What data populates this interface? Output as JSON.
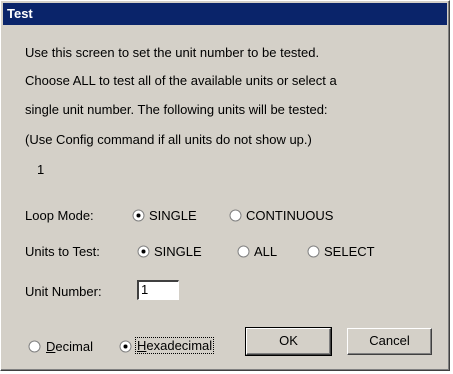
{
  "window": {
    "title": "Test"
  },
  "instructions": {
    "line1": "Use this screen to set the unit number to be tested.",
    "line2": "Choose ALL to test all of the available units or select a",
    "line3": "single unit number.  The following units will be tested:",
    "line4": "(Use Config command if all units do not show up.)",
    "units_listed": "1"
  },
  "loop_mode": {
    "label": "Loop Mode:",
    "options": [
      {
        "label": "SINGLE",
        "selected": true
      },
      {
        "label": "CONTINUOUS",
        "selected": false
      }
    ]
  },
  "units_to_test": {
    "label": "Units to Test:",
    "options": [
      {
        "label": "SINGLE",
        "selected": true
      },
      {
        "label": "ALL",
        "selected": false
      },
      {
        "label": "SELECT",
        "selected": false
      }
    ]
  },
  "unit_number": {
    "label": "Unit Number:",
    "value": "1"
  },
  "number_format": {
    "decimal_first": "D",
    "decimal_rest": "ecimal",
    "hex_first": "H",
    "hex_rest": "exadecimal",
    "selected": "hexadecimal"
  },
  "buttons": {
    "ok": "OK",
    "cancel": "Cancel"
  }
}
